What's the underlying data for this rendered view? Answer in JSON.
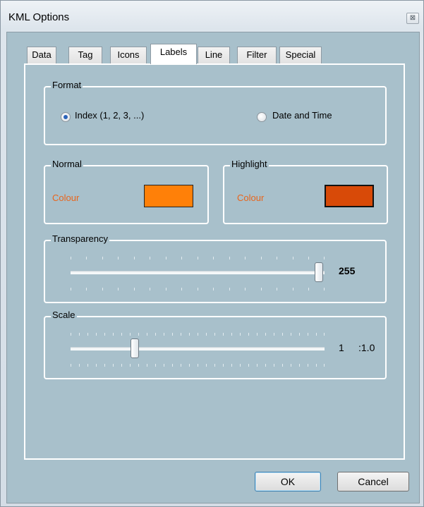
{
  "window": {
    "title": "KML Options",
    "close_symbol": "⊠"
  },
  "tabs": [
    {
      "label": "Data",
      "active": false
    },
    {
      "label": "Tag",
      "active": false
    },
    {
      "label": "Icons",
      "active": false
    },
    {
      "label": "Labels",
      "active": true
    },
    {
      "label": "Line",
      "active": false
    },
    {
      "label": "Filter",
      "active": false
    },
    {
      "label": "Special",
      "active": false
    }
  ],
  "format": {
    "title": "Format",
    "options": [
      {
        "label": "Index (1, 2, 3, ...)",
        "checked": true
      },
      {
        "label": "Date and Time",
        "checked": false
      }
    ]
  },
  "normal": {
    "title": "Normal",
    "colour_label": "Colour",
    "label_color": "#e8651c",
    "swatch_color": "#ff8008"
  },
  "highlight": {
    "title": "Highlight",
    "colour_label": "Colour",
    "label_color": "#e8651c",
    "swatch_color": "#d84a08"
  },
  "transparency": {
    "title": "Transparency",
    "value": "255",
    "min": 0,
    "max": 255,
    "current": 255
  },
  "scale": {
    "title": "Scale",
    "value": "1",
    "ratio": ":1.0",
    "position": 0.2
  },
  "buttons": {
    "ok": "OK",
    "cancel": "Cancel"
  }
}
